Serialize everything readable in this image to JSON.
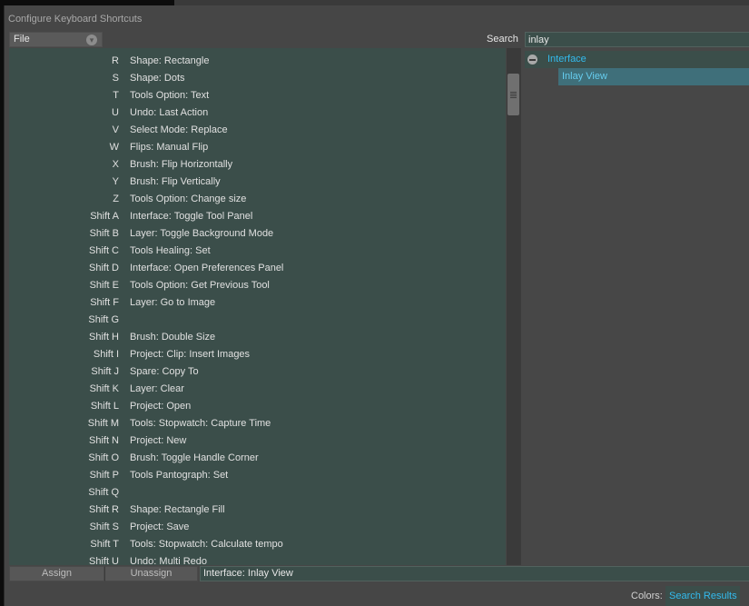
{
  "window": {
    "title": "Configure Keyboard Shortcuts"
  },
  "filter": {
    "selected": "File"
  },
  "search": {
    "label": "Search",
    "value": "inlay"
  },
  "shortcuts": [
    {
      "key": "R",
      "action": "Shape: Rectangle"
    },
    {
      "key": "S",
      "action": "Shape: Dots"
    },
    {
      "key": "T",
      "action": "Tools Option: Text"
    },
    {
      "key": "U",
      "action": "Undo: Last Action"
    },
    {
      "key": "V",
      "action": "Select Mode: Replace"
    },
    {
      "key": "W",
      "action": "Flips: Manual Flip"
    },
    {
      "key": "X",
      "action": "Brush: Flip Horizontally"
    },
    {
      "key": "Y",
      "action": "Brush: Flip Vertically"
    },
    {
      "key": "Z",
      "action": "Tools Option: Change size"
    },
    {
      "key": "Shift A",
      "action": "Interface: Toggle Tool Panel"
    },
    {
      "key": "Shift B",
      "action": "Layer: Toggle Background Mode"
    },
    {
      "key": "Shift C",
      "action": "Tools Healing: Set"
    },
    {
      "key": "Shift D",
      "action": "Interface: Open Preferences Panel"
    },
    {
      "key": "Shift E",
      "action": "Tools Option: Get Previous Tool"
    },
    {
      "key": "Shift F",
      "action": "Layer: Go to Image"
    },
    {
      "key": "Shift G",
      "action": ""
    },
    {
      "key": "Shift H",
      "action": "Brush: Double Size"
    },
    {
      "key": "Shift I",
      "action": "Project: Clip: Insert Images"
    },
    {
      "key": "Shift J",
      "action": "Spare: Copy To"
    },
    {
      "key": "Shift K",
      "action": "Layer: Clear"
    },
    {
      "key": "Shift L",
      "action": "Project: Open"
    },
    {
      "key": "Shift M",
      "action": "Tools: Stopwatch: Capture Time"
    },
    {
      "key": "Shift N",
      "action": "Project: New"
    },
    {
      "key": "Shift O",
      "action": "Brush: Toggle Handle Corner"
    },
    {
      "key": "Shift P",
      "action": "Tools Pantograph: Set"
    },
    {
      "key": "Shift Q",
      "action": ""
    },
    {
      "key": "Shift R",
      "action": "Shape: Rectangle Fill"
    },
    {
      "key": "Shift S",
      "action": "Project: Save"
    },
    {
      "key": "Shift T",
      "action": "Tools: Stopwatch: Calculate tempo"
    },
    {
      "key": "Shift U",
      "action": "Undo: Multi Redo"
    }
  ],
  "tree": {
    "group": "Interface",
    "item": "Inlay View"
  },
  "buttons": {
    "assign": "Assign",
    "unassign": "Unassign"
  },
  "current_binding": "Interface: Inlay View",
  "colors": {
    "label": "Colors:",
    "value": "Search Results",
    "accent": "#33bbee"
  }
}
